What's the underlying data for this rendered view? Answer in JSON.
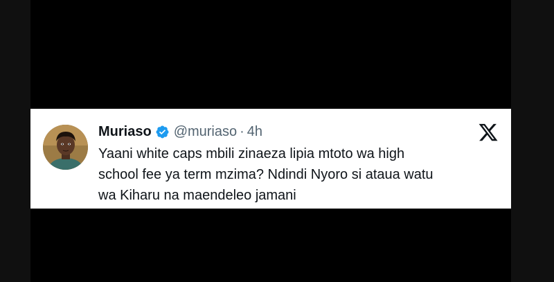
{
  "tweet": {
    "display_name": "Muriaso",
    "handle": "@muriaso",
    "separator": "·",
    "time": "4h",
    "text_lines": [
      "Yaani white caps mbili zinaeza lipia mtoto wa high",
      "school fee ya term mzima? Ndindi Nyoro si ataua watu",
      "wa Kiharu na maendeleo jamani"
    ]
  },
  "icons": {
    "verified": "verified-badge-icon",
    "platform": "x-logo-icon"
  },
  "colors": {
    "background": "#000000",
    "card": "#ffffff",
    "text": "#0f1419",
    "muted": "#536471",
    "verified_blue": "#1d9bf0"
  }
}
